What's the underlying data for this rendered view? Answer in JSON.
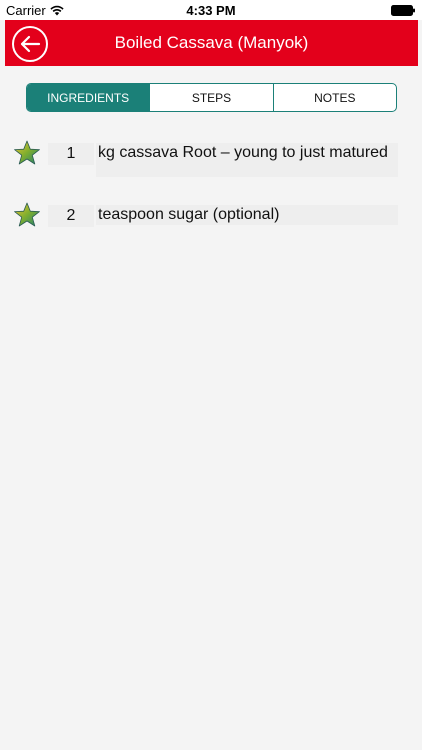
{
  "status_bar": {
    "carrier": "Carrier",
    "time": "4:33 PM",
    "wifi_icon": "wifi-icon",
    "battery_icon": "battery-icon"
  },
  "nav": {
    "title": "Boiled Cassava (Manyok)",
    "back_icon": "back-arrow-icon",
    "color": "#e3001b"
  },
  "tabs": [
    {
      "label": "INGREDIENTS",
      "active": true
    },
    {
      "label": "STEPS",
      "active": false
    },
    {
      "label": "NOTES",
      "active": false
    }
  ],
  "accent_color": "#1b8078",
  "ingredients": [
    {
      "icon": "star-icon",
      "quantity": "1",
      "text": "kg cassava Root – young to just matured"
    },
    {
      "icon": "star-icon",
      "quantity": "2",
      "text": "teaspoon sugar (optional)"
    }
  ]
}
